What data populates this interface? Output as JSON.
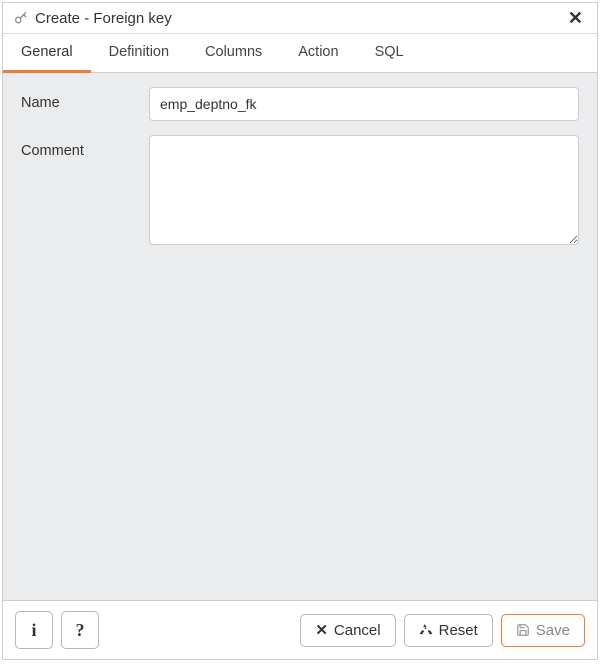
{
  "title": "Create - Foreign key",
  "tabs": [
    {
      "label": "General"
    },
    {
      "label": "Definition"
    },
    {
      "label": "Columns"
    },
    {
      "label": "Action"
    },
    {
      "label": "SQL"
    }
  ],
  "active_tab_index": 0,
  "fields": {
    "name": {
      "label": "Name",
      "value": "emp_deptno_fk"
    },
    "comment": {
      "label": "Comment",
      "value": ""
    }
  },
  "footer": {
    "info_label": "i",
    "help_label": "?",
    "cancel_label": "Cancel",
    "reset_label": "Reset",
    "save_label": "Save"
  }
}
